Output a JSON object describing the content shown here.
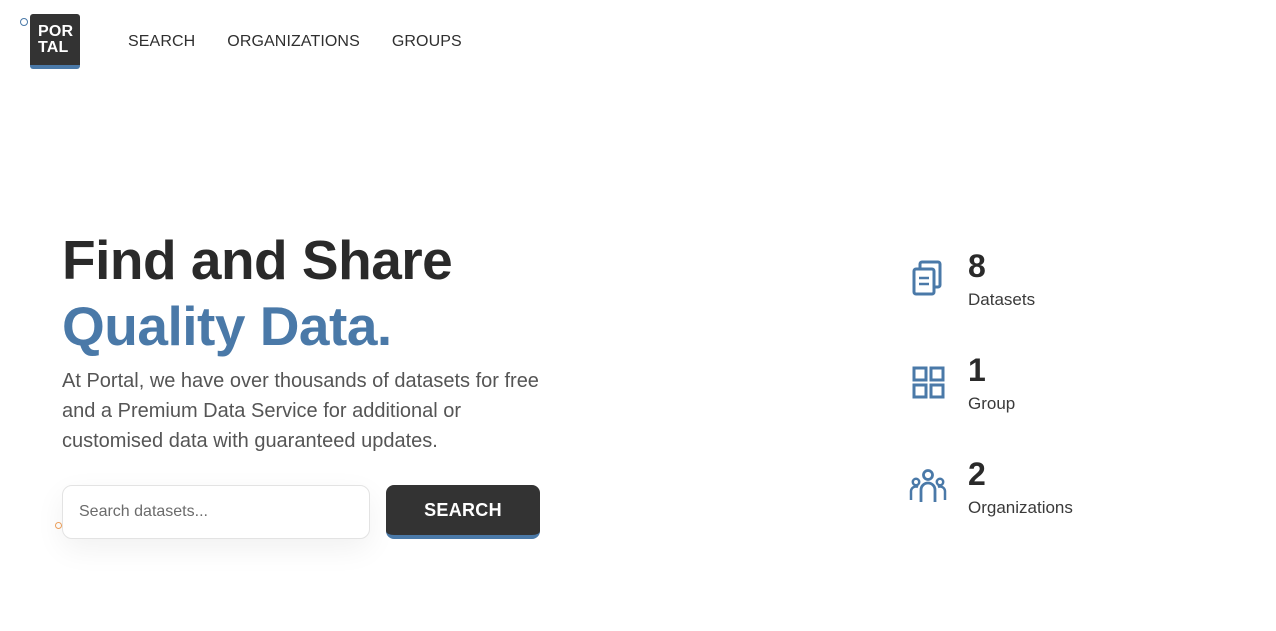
{
  "header": {
    "logo_line1": "POR",
    "logo_line2": "TAL",
    "nav": [
      "SEARCH",
      "ORGANIZATIONS",
      "GROUPS"
    ]
  },
  "hero": {
    "title_line1": "Find and Share",
    "title_line2": "Quality Data.",
    "description": "At Portal, we have over thousands of datasets for free and a Premium Data Service for additional or customised data with guaranteed updates.",
    "search_placeholder": "Search datasets...",
    "search_button": "SEARCH"
  },
  "stats": [
    {
      "value": "8",
      "label": "Datasets",
      "icon": "documents-icon"
    },
    {
      "value": "1",
      "label": "Group",
      "icon": "grid-icon"
    },
    {
      "value": "2",
      "label": "Organizations",
      "icon": "people-icon"
    }
  ],
  "colors": {
    "accent": "#4a79a8",
    "dark": "#333333"
  }
}
